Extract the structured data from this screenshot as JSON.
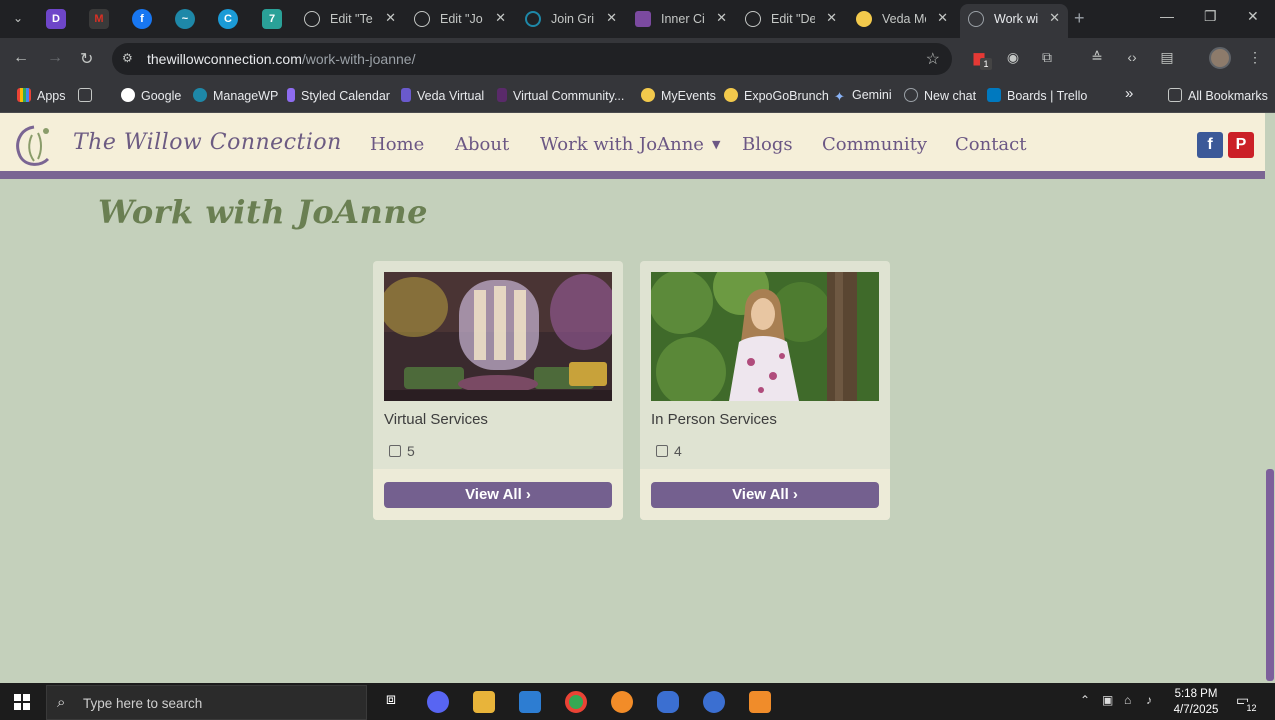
{
  "browser": {
    "pinned_tabs": [
      {
        "icon": "dash-icon",
        "letter": "D",
        "color": "#6e46c9"
      },
      {
        "icon": "gmail-icon",
        "letter": "M",
        "color": "#d93025"
      },
      {
        "icon": "facebook-icon",
        "letter": "f",
        "color": "#1877f2"
      },
      {
        "icon": "managewp-icon",
        "letter": "~",
        "color": "#1e88a8"
      },
      {
        "icon": "canva-icon",
        "letter": "C",
        "color": "#1b9bd7"
      },
      {
        "icon": "calendar-icon",
        "letter": "7",
        "color": "#2aa198"
      }
    ],
    "tabs": [
      {
        "title": "Edit \"Te",
        "icon": "wordpress-icon"
      },
      {
        "title": "Edit \"Jo",
        "icon": "wordpress-icon"
      },
      {
        "title": "Join Grin",
        "icon": "circle-icon"
      },
      {
        "title": "Inner Cir",
        "icon": "trello-icon"
      },
      {
        "title": "Edit \"De",
        "icon": "wordpress-icon"
      },
      {
        "title": "Veda Me",
        "icon": "veda-icon"
      },
      {
        "title": "Work wi",
        "icon": "willow-icon",
        "active": true
      }
    ],
    "url_host": "thewillowconnection.com",
    "url_path": "/work-with-joanne/",
    "extension_badge": "1",
    "bookmarks": [
      {
        "label": "Apps",
        "icon": "apps-icon"
      },
      {
        "label": "",
        "icon": "grid-icon"
      },
      {
        "label": "Google",
        "icon": "google-icon"
      },
      {
        "label": "ManageWP",
        "icon": "managewp-icon"
      },
      {
        "label": "Styled Calendar",
        "icon": "calendar-icon"
      },
      {
        "label": "Veda Virtual",
        "icon": "veda-icon"
      },
      {
        "label": "Virtual Community...",
        "icon": "community-icon"
      },
      {
        "label": "MyEvents",
        "icon": "events-icon"
      },
      {
        "label": "ExpoGoBrunch",
        "icon": "expo-icon"
      },
      {
        "label": "Gemini",
        "icon": "gemini-icon"
      },
      {
        "label": "New chat",
        "icon": "chat-icon"
      },
      {
        "label": "Boards | Trello",
        "icon": "trello-icon"
      }
    ],
    "more_bookmarks": "»",
    "all_bookmarks": "All Bookmarks"
  },
  "site": {
    "logo_text": "The Willow Connection",
    "nav": [
      "Home",
      "About",
      "Work with JoAnne",
      "Blogs",
      "Community",
      "Contact"
    ],
    "social": [
      {
        "icon": "facebook-icon",
        "glyph": "f",
        "color": "#3b5998"
      },
      {
        "icon": "pinterest-icon",
        "glyph": "P",
        "color": "#cb2027"
      }
    ],
    "page_title": "Work with JoAnne",
    "cards": [
      {
        "title": "Virtual Services",
        "count": "5",
        "button": "View All ›",
        "image": "virtual-room-image"
      },
      {
        "title": "In Person Services",
        "count": "4",
        "button": "View All ›",
        "image": "joanne-portrait-image"
      }
    ]
  },
  "taskbar": {
    "search_placeholder": "Type here to search",
    "time": "5:18 PM",
    "date": "4/7/2025",
    "notifications": "12",
    "colors": {
      "accent": "#74608f"
    }
  }
}
